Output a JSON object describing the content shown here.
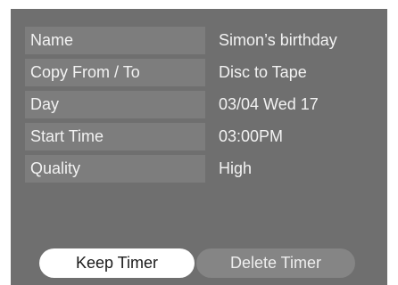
{
  "fields": [
    {
      "label": "Name",
      "value": "Simon’s birthday"
    },
    {
      "label": "Copy From / To",
      "value": "Disc to Tape"
    },
    {
      "label": "Day",
      "value": "03/04 Wed 17"
    },
    {
      "label": "Start Time",
      "value": "03:00PM"
    },
    {
      "label": "Quality",
      "value": "High"
    }
  ],
  "buttons": {
    "keep_label": "Keep Timer",
    "delete_label": "Delete Timer"
  }
}
